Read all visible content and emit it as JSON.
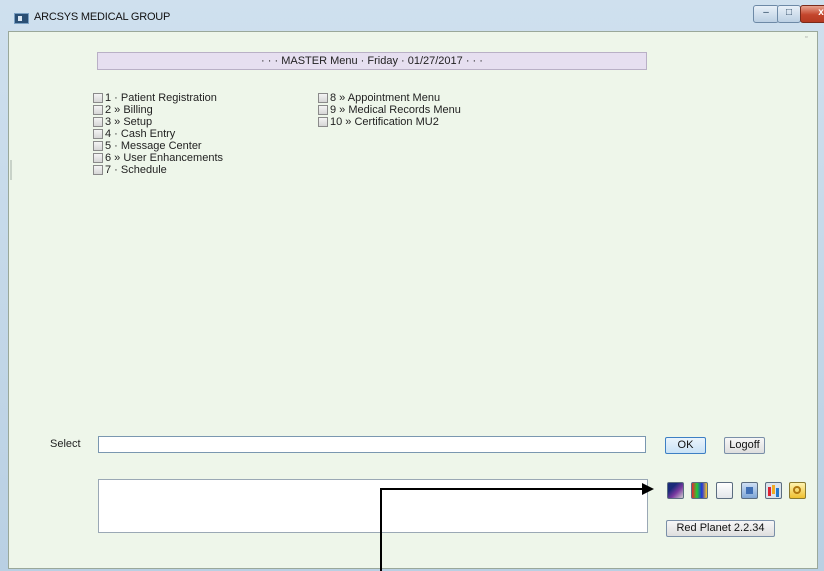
{
  "window": {
    "title": "ARCSYS MEDICAL GROUP",
    "controls": {
      "minimize": "–",
      "maximize": "□",
      "close": "x"
    }
  },
  "banner": {
    "text": "· · · MASTER Menu · Friday · 01/27/2017 · · ·"
  },
  "menu": {
    "left": [
      {
        "label": "1 · Patient Registration"
      },
      {
        "label": "2 » Billing"
      },
      {
        "label": "3 » Setup"
      },
      {
        "label": "4 · Cash Entry"
      },
      {
        "label": "5 · Message Center"
      },
      {
        "label": "6 » User Enhancements"
      },
      {
        "label": "7 · Schedule"
      }
    ],
    "right": [
      {
        "label": "8 » Appointment Menu"
      },
      {
        "label": "9 » Medical Records Menu"
      },
      {
        "label": "10 » Certification MU2"
      }
    ]
  },
  "select": {
    "label": "Select",
    "value": ""
  },
  "buttons": {
    "ok": "OK",
    "logoff": "Logoff",
    "version": "Red Planet 2.2.34"
  },
  "toolbar_icons": [
    "image-icon",
    "color-palette-icon",
    "blank-document-icon",
    "window-icon",
    "bar-chart-icon",
    "key-icon"
  ]
}
